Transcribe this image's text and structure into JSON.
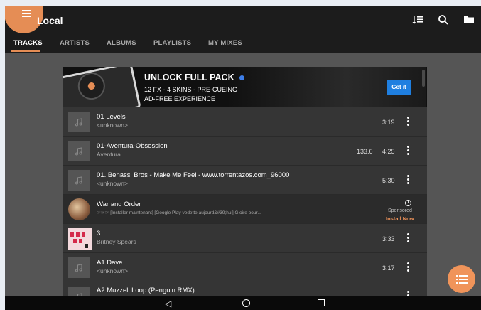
{
  "app": {
    "title": "Local"
  },
  "toolbar": {
    "icons": [
      "sort-icon",
      "search-icon",
      "folder-icon"
    ]
  },
  "tabs": [
    {
      "label": "TRACKS",
      "active": true
    },
    {
      "label": "ARTISTS",
      "active": false
    },
    {
      "label": "ALBUMS",
      "active": false
    },
    {
      "label": "PLAYLISTS",
      "active": false
    },
    {
      "label": "MY MIXES",
      "active": false
    }
  ],
  "banner": {
    "title": "UNLOCK FULL PACK",
    "line1": "12 FX - 4 SKINS - PRE-CUEING",
    "line2": "AD-FREE EXPERIENCE",
    "button": "Get it"
  },
  "tracks": [
    {
      "title": "01 Levels",
      "artist": "<unknown>",
      "bpm": "",
      "duration": "3:19"
    },
    {
      "title": "01-Aventura-Obsession",
      "artist": "Aventura",
      "bpm": "133.6",
      "duration": "4:25"
    },
    {
      "title": "01. Benassi Bros - Make Me Feel - www.torrentazos.com_96000",
      "artist": "<unknown>",
      "bpm": "",
      "duration": "5:30"
    }
  ],
  "ad": {
    "title": "War and Order",
    "subtitle": "☞☞☞ [Installer maintenant] [Google Play vedette aujourd&#39;hui] Gloire pour...",
    "sponsored": "Sponsored",
    "install": "Install Now"
  },
  "tracks2": [
    {
      "title": "3",
      "artist": "Britney Spears",
      "bpm": "",
      "duration": "3:33"
    },
    {
      "title": "A1 Dave",
      "artist": "<unknown>",
      "bpm": "",
      "duration": "3:17"
    },
    {
      "title": "A2 Muzzell Loop (Penguin RMX)",
      "artist": "",
      "bpm": "",
      "duration": ""
    }
  ],
  "colors": {
    "accent": "#e58d55",
    "install": "#f0935a",
    "button": "#1f7fe0"
  },
  "navbar": {
    "icons": [
      "back-icon",
      "home-icon",
      "recents-icon"
    ]
  }
}
